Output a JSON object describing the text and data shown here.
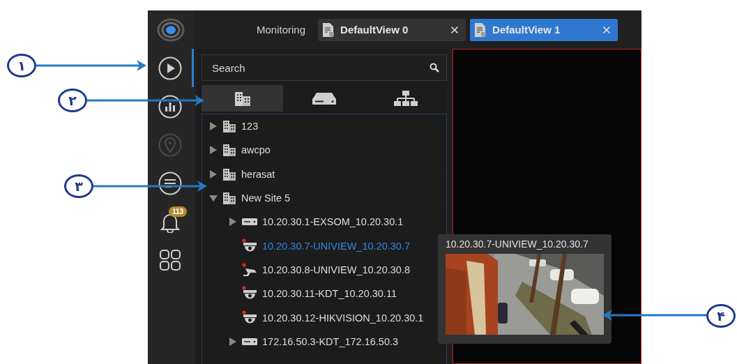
{
  "callouts": [
    {
      "label": "۱"
    },
    {
      "label": "۲"
    },
    {
      "label": "۳"
    },
    {
      "label": "۴"
    }
  ],
  "rail": [
    {
      "kind": "play",
      "selected": true,
      "disabled": false
    },
    {
      "kind": "chart",
      "selected": false,
      "disabled": false
    },
    {
      "kind": "pin",
      "selected": false,
      "disabled": true
    },
    {
      "kind": "list",
      "selected": false,
      "disabled": false
    },
    {
      "kind": "bell",
      "selected": false,
      "disabled": false,
      "badge": "113"
    },
    {
      "kind": "grid",
      "selected": false,
      "disabled": false
    }
  ],
  "section_label": "Monitoring",
  "tabs": [
    {
      "label": "DefaultView 0",
      "selected": false
    },
    {
      "label": "DefaultView 1",
      "selected": true
    }
  ],
  "search": {
    "placeholder": "Search"
  },
  "view_tabs": [
    {
      "kind": "sites",
      "selected": true
    },
    {
      "kind": "devices",
      "selected": false
    },
    {
      "kind": "topology",
      "selected": false
    }
  ],
  "tree": [
    {
      "label": "123",
      "kind": "site",
      "expanded": false,
      "selected": false
    },
    {
      "label": "awcpo",
      "kind": "site",
      "expanded": false,
      "selected": false
    },
    {
      "label": "herasat",
      "kind": "site",
      "expanded": false,
      "selected": false
    },
    {
      "label": "New Site 5",
      "kind": "site",
      "expanded": true,
      "selected": false,
      "children": [
        {
          "label": "10.20.30.1-EXSOM_10.20.30.1",
          "kind": "device",
          "expanded": false,
          "selected": false
        },
        {
          "label": "10.20.30.7-UNIVIEW_10.20.30.7",
          "kind": "dome",
          "selected": true
        },
        {
          "label": "10.20.30.8-UNIVIEW_10.20.30.8",
          "kind": "bullet",
          "selected": false
        },
        {
          "label": "10.20.30.11-KDT_10.20.30.11",
          "kind": "dome",
          "selected": false
        },
        {
          "label": "10.20.30.12-HIKVISION_10.20.30.1",
          "kind": "dome",
          "selected": false
        },
        {
          "label": "172.16.50.3-KDT_172.16.50.3",
          "kind": "device",
          "expanded": false,
          "selected": false
        }
      ]
    }
  ],
  "video_tile": {
    "selected": true
  },
  "preview": {
    "title": "10.20.30.7-UNIVIEW_10.20.30.7",
    "kind": "picture"
  }
}
